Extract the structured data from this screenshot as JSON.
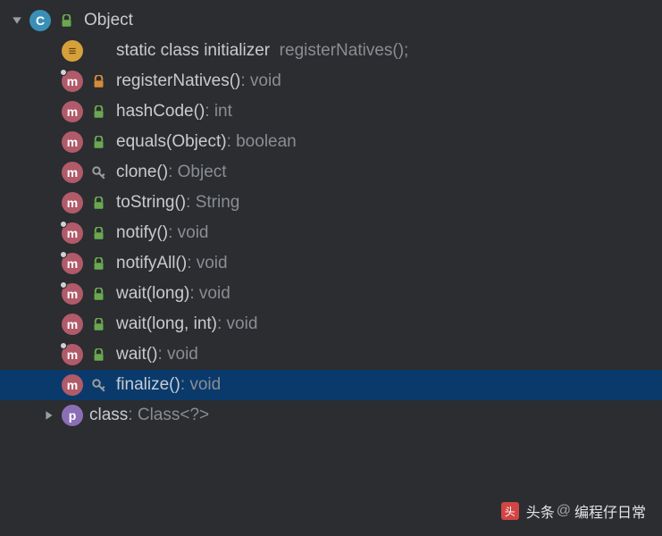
{
  "root": {
    "name": "Object",
    "icon_letter": "C",
    "children": [
      {
        "icon": "init",
        "access": "none",
        "native": false,
        "label": "static class initializer",
        "ret": "registerNatives();",
        "selected": false
      },
      {
        "icon": "method",
        "access": "private",
        "native": true,
        "label": "registerNatives()",
        "ret": "void",
        "selected": false
      },
      {
        "icon": "method",
        "access": "public",
        "native": false,
        "label": "hashCode()",
        "ret": "int",
        "selected": false
      },
      {
        "icon": "method",
        "access": "public",
        "native": false,
        "label": "equals(Object)",
        "ret": "boolean",
        "selected": false
      },
      {
        "icon": "method",
        "access": "protected",
        "native": false,
        "label": "clone()",
        "ret": "Object",
        "selected": false
      },
      {
        "icon": "method",
        "access": "public",
        "native": false,
        "label": "toString()",
        "ret": "String",
        "selected": false
      },
      {
        "icon": "method",
        "access": "public",
        "native": true,
        "label": "notify()",
        "ret": "void",
        "selected": false
      },
      {
        "icon": "method",
        "access": "public",
        "native": true,
        "label": "notifyAll()",
        "ret": "void",
        "selected": false
      },
      {
        "icon": "method",
        "access": "public",
        "native": true,
        "label": "wait(long)",
        "ret": "void",
        "selected": false
      },
      {
        "icon": "method",
        "access": "public",
        "native": false,
        "label": "wait(long, int)",
        "ret": "void",
        "selected": false
      },
      {
        "icon": "method",
        "access": "public",
        "native": true,
        "label": "wait()",
        "ret": "void",
        "selected": false
      },
      {
        "icon": "method",
        "access": "protected",
        "native": false,
        "label": "finalize()",
        "ret": "void",
        "selected": true
      }
    ],
    "sibling": {
      "icon_letter": "p",
      "label": "class",
      "ret": "Class<?>"
    }
  },
  "watermark": {
    "brand": "头条",
    "at": "@",
    "text": "编程仔日常"
  }
}
